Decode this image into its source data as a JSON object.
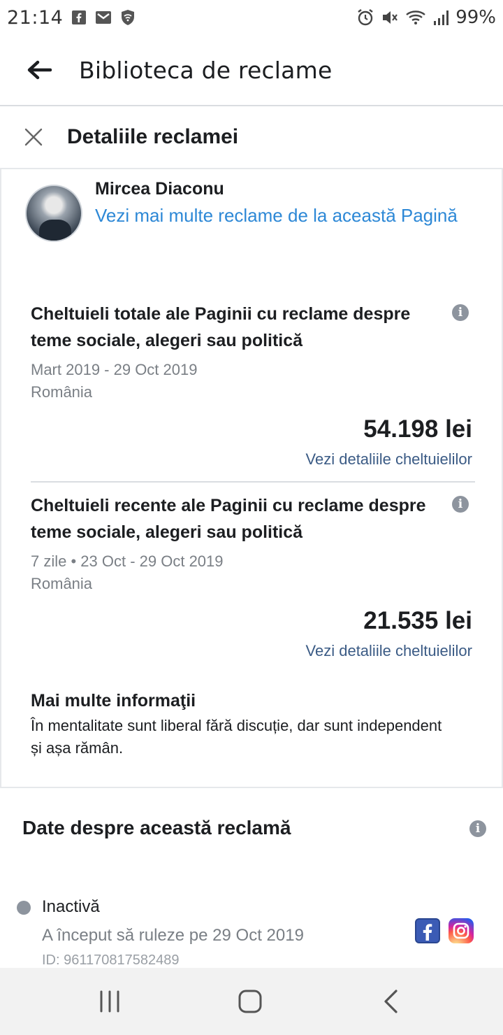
{
  "status_bar": {
    "time": "21:14",
    "battery": "99%",
    "left_icons": [
      "facebook-icon",
      "mail-icon",
      "shield-wifi-icon"
    ],
    "right_icons": [
      "alarm-icon",
      "mute-icon",
      "wifi-icon",
      "signal-icon"
    ]
  },
  "header": {
    "title": "Biblioteca de reclame"
  },
  "detail": {
    "title": "Detaliile reclamei"
  },
  "page": {
    "name": "Mircea Diaconu",
    "link": "Vezi mai multe reclame de la această Pagină"
  },
  "total_spend": {
    "title": "Cheltuieli totale ale Paginii cu reclame despre teme sociale, alegeri sau politică",
    "period": "Mart 2019 - 29 Oct 2019",
    "country": "România",
    "amount": "54.198 lei",
    "link": "Vezi detaliile cheltuielilor"
  },
  "recent_spend": {
    "title": "Cheltuieli recente ale Paginii cu reclame despre teme sociale, alegeri sau politică",
    "period": "7 zile • 23 Oct - 29 Oct 2019",
    "country": "România",
    "amount": "21.535 lei",
    "link": "Vezi detaliile cheltuielilor"
  },
  "more_info": {
    "title": "Mai multe informaţii",
    "text": "În mentalitate sunt liberal fără discuție, dar sunt independent și așa rămân."
  },
  "ad_data": {
    "title": "Date despre această reclamă",
    "status": "Inactivă",
    "started": "A început să ruleze pe 29 Oct 2019",
    "id": "ID: 961170817582489",
    "platforms": [
      "facebook-icon",
      "instagram-icon"
    ]
  },
  "colors": {
    "link": "#2d88d6",
    "spend_link": "#3b5b85",
    "muted": "#7a7f85"
  }
}
